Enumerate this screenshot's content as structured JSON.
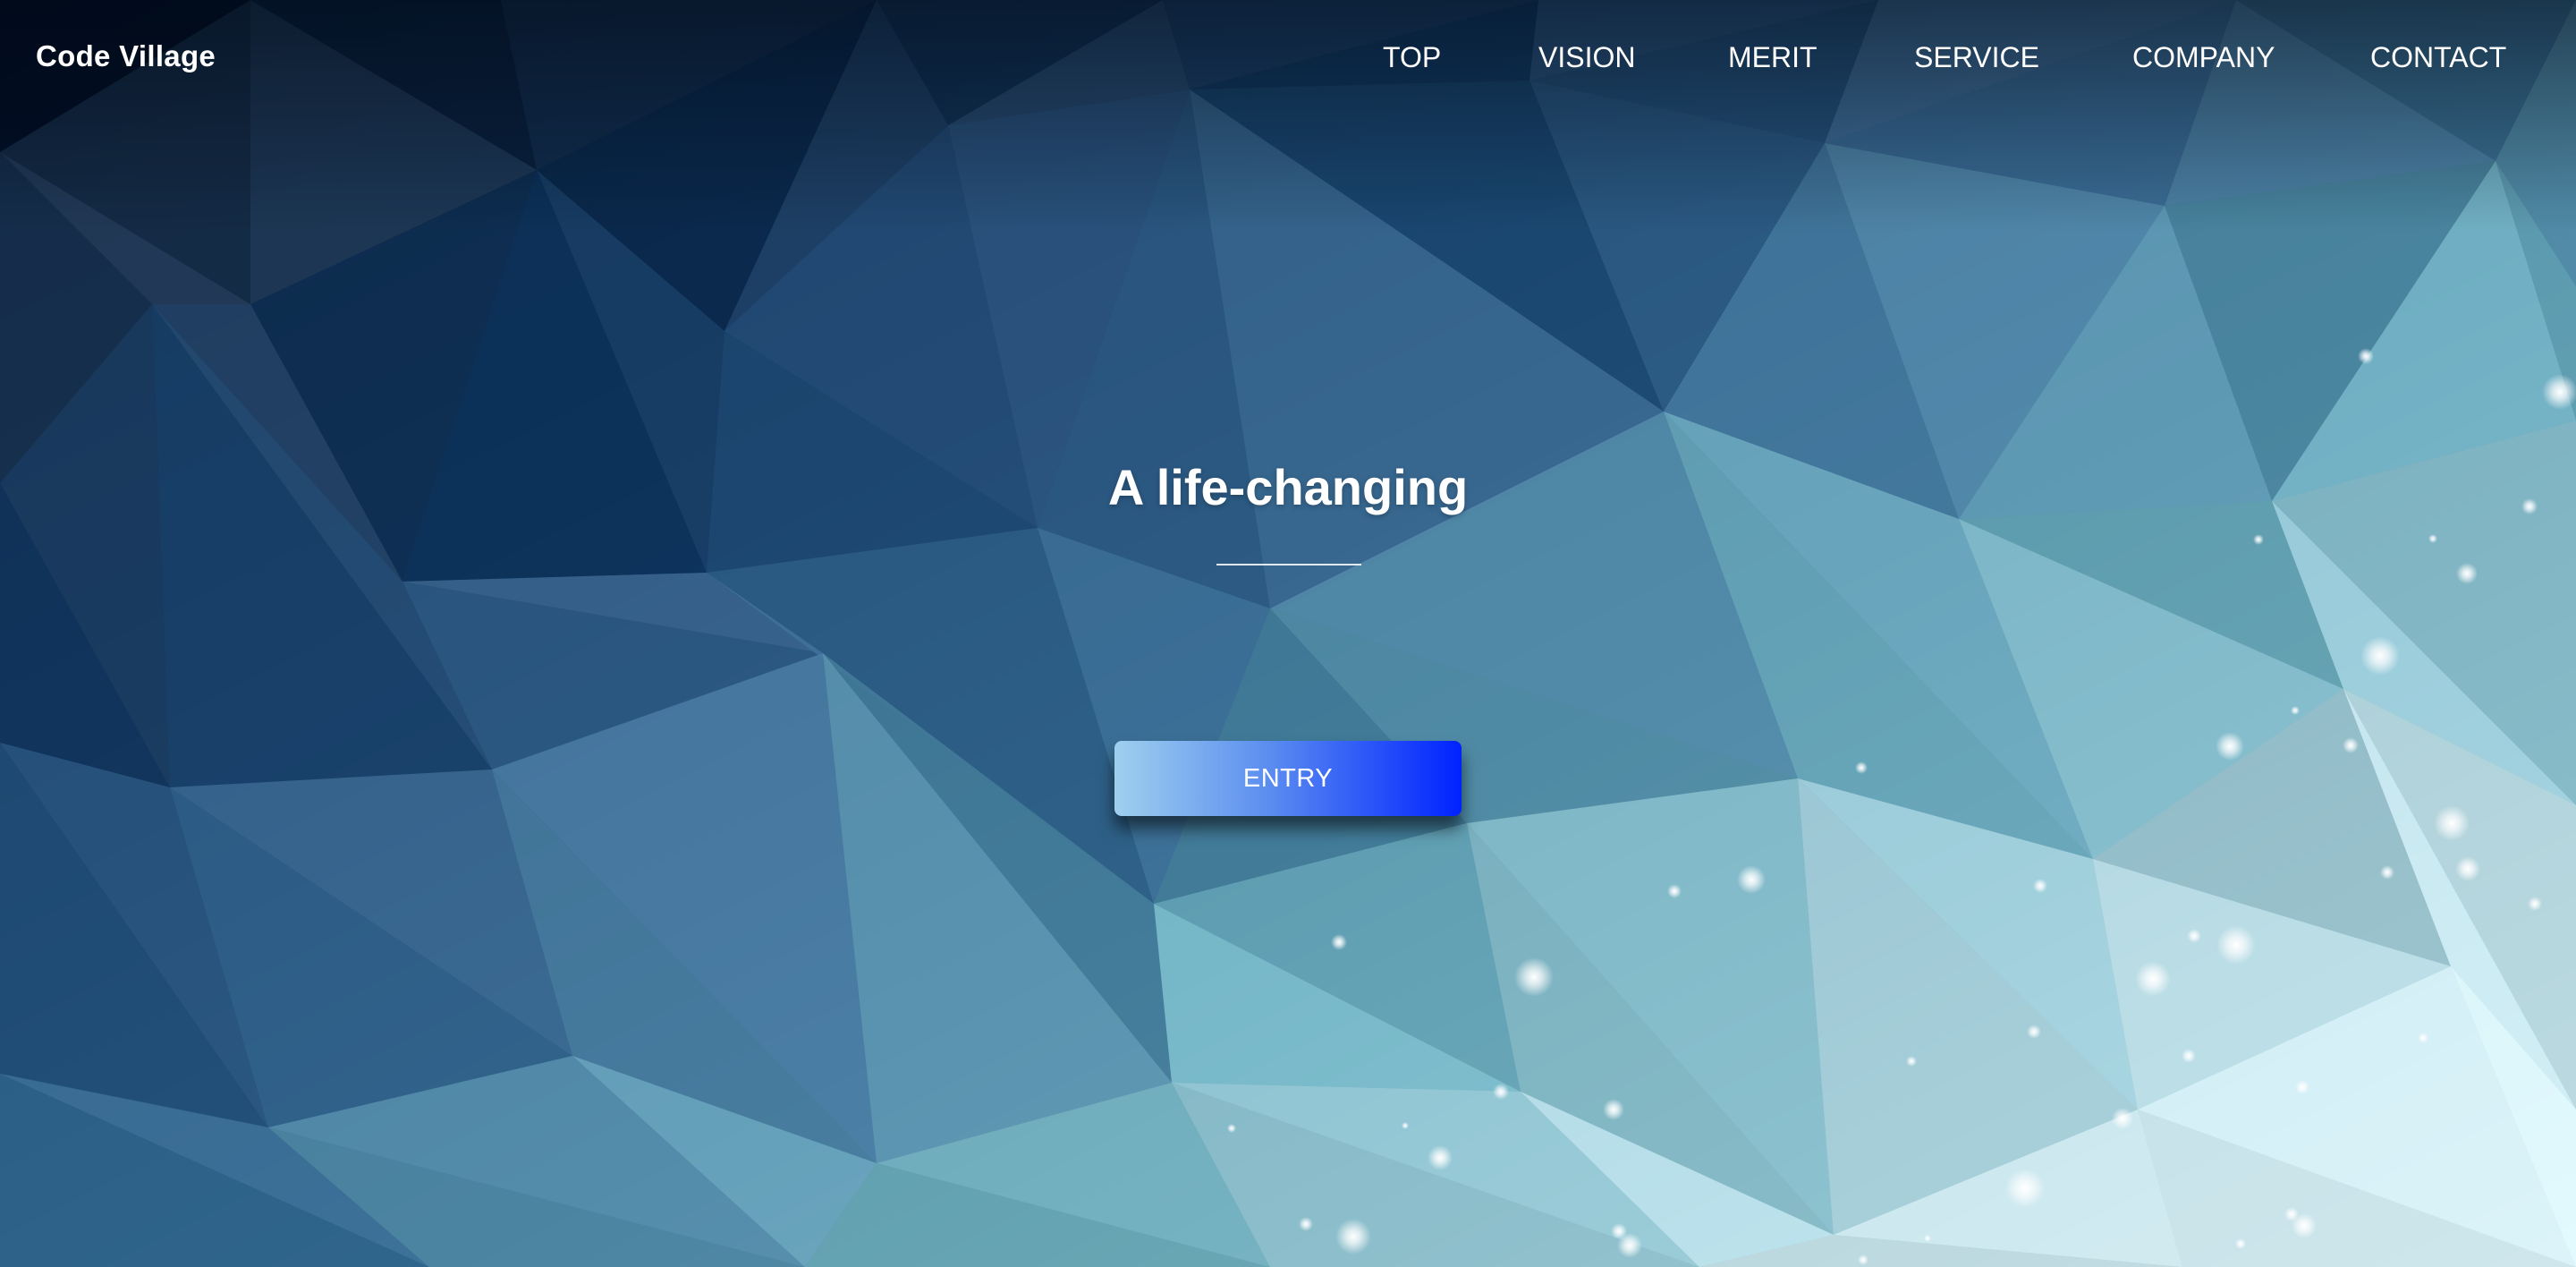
{
  "header": {
    "logo": "Code Village",
    "nav": [
      {
        "label": "TOP"
      },
      {
        "label": "VISION"
      },
      {
        "label": "MERIT"
      },
      {
        "label": "SERVICE"
      },
      {
        "label": "COMPANY"
      },
      {
        "label": "CONTACT"
      }
    ]
  },
  "hero": {
    "title": "A life-changing",
    "entry_label": "ENTRY"
  },
  "colors": {
    "background_dark": "#0b1a2e",
    "background_light": "#cfe8ee",
    "button_gradient_start": "#9fd0ee",
    "button_gradient_end": "#0022ff",
    "text": "#ffffff"
  },
  "icons": {
    "background": "low-poly-triangle-pattern",
    "particles": "sparkle-dots"
  }
}
